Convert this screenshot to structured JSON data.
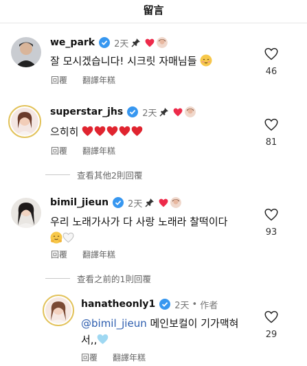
{
  "header": {
    "title": "留言"
  },
  "comments": [
    {
      "username": "we_park",
      "time": "2天",
      "text": "잘 모시겠습니다! 시크릿 자매님들",
      "reply_label": "回覆",
      "translate_label": "翻譯年糕",
      "likes": "46"
    },
    {
      "username": "superstar_jhs",
      "time": "2天",
      "text": "으히히",
      "reply_label": "回覆",
      "translate_label": "翻譯年糕",
      "likes": "81",
      "view_replies": "查看其他2則回覆"
    },
    {
      "username": "bimil_jieun",
      "time": "2天",
      "text": "우리 노래가사가 다 사랑 노래라 찰떡이다",
      "reply_label": "回覆",
      "translate_label": "翻譯年糕",
      "likes": "93",
      "view_replies": "查看之前的1則回覆"
    },
    {
      "username": "hanatheonly1",
      "time": "2天",
      "author_label": "作者",
      "mention": "@bimil_jieun",
      "text_line1": " 메인보컬이 기가맥혀",
      "text_line2": "서,,",
      "reply_label": "回覆",
      "translate_label": "翻譯年糕",
      "likes": "29"
    }
  ],
  "colors": {
    "verified": "#3797f0",
    "heart": "#ed2a4a",
    "mention": "#2b5cae",
    "muted": "#777777"
  },
  "icons": [
    "verified-badge-icon",
    "pin-icon",
    "heart-icon",
    "heart-outline-icon",
    "blush-emoji-icon",
    "hug-emoji-icon",
    "white-heart-icon",
    "blue-heart-icon"
  ]
}
